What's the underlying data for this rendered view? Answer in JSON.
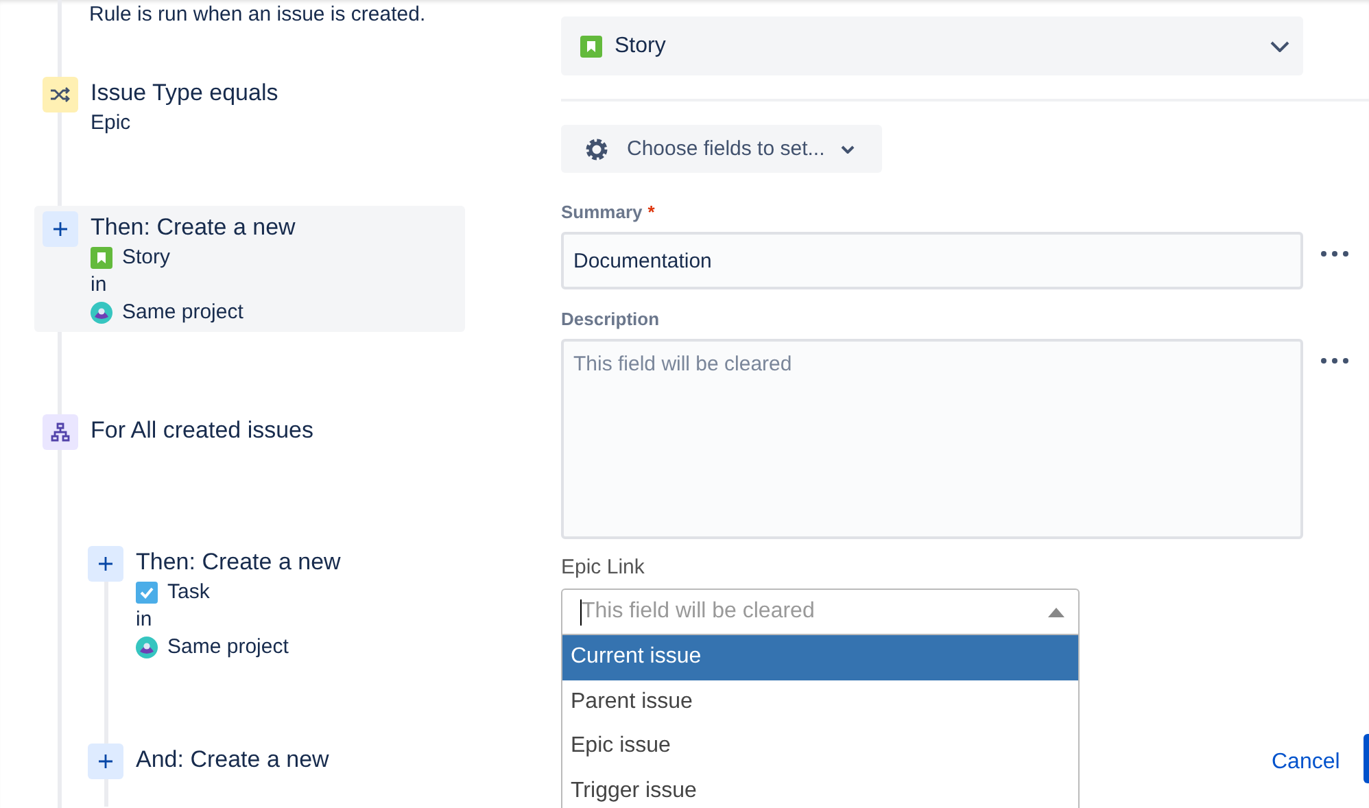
{
  "trigger": {
    "description": "Rule is run when an issue is created."
  },
  "components": [
    {
      "kind": "condition",
      "title": "Issue Type equals",
      "detail": "Epic"
    },
    {
      "kind": "action",
      "title": "Then: Create a new",
      "issue_type": {
        "kind": "story",
        "name": "Story"
      },
      "preposition": "in",
      "project": "Same project",
      "selected": true
    },
    {
      "kind": "branch",
      "title": "For All created issues",
      "children": [
        {
          "kind": "action",
          "title": "Then: Create a new",
          "issue_type": {
            "kind": "task",
            "name": "Task"
          },
          "preposition": "in",
          "project": "Same project",
          "selected": false
        },
        {
          "kind": "action",
          "title": "And: Create a new",
          "selected": false
        }
      ]
    }
  ],
  "issue_type_select": {
    "kind": "story",
    "value": "Story"
  },
  "fields_button": {
    "label": "Choose fields to set..."
  },
  "fields": [
    {
      "kind": "text",
      "label": "Summary",
      "required_mark": "*",
      "value": "Documentation"
    },
    {
      "kind": "textarea",
      "label": "Description",
      "placeholder": "This field will be cleared"
    }
  ],
  "epic_link": {
    "label": "Epic Link",
    "placeholder": "This field will be cleared",
    "expanded": true,
    "options": [
      {
        "label": "Current issue",
        "selected": true
      },
      {
        "label": "Parent issue",
        "selected": false
      },
      {
        "label": "Epic issue",
        "selected": false
      },
      {
        "label": "Trigger issue",
        "selected": false
      }
    ]
  },
  "actions": {
    "cancel": "Cancel"
  }
}
